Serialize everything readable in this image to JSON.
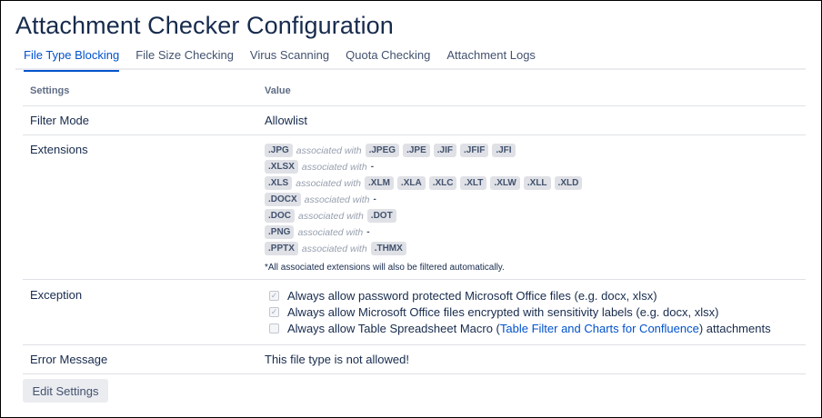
{
  "title": "Attachment Checker Configuration",
  "tabs": [
    "File Type Blocking",
    "File Size Checking",
    "Virus Scanning",
    "Quota Checking",
    "Attachment Logs"
  ],
  "active_tab": "File Type Blocking",
  "table": {
    "headers": {
      "settings": "Settings",
      "value": "Value"
    },
    "filter_mode": {
      "label": "Filter Mode",
      "value": "Allowlist"
    },
    "extensions": {
      "label": "Extensions",
      "assoc_text": "associated with",
      "none_text": "-",
      "items": [
        {
          "ext": ".JPG",
          "assoc": [
            ".JPEG",
            ".JPE",
            ".JIF",
            ".JFIF",
            ".JFI"
          ]
        },
        {
          "ext": ".XLSX",
          "assoc": []
        },
        {
          "ext": ".XLS",
          "assoc": [
            ".XLM",
            ".XLA",
            ".XLC",
            ".XLT",
            ".XLW",
            ".XLL",
            ".XLD"
          ]
        },
        {
          "ext": ".DOCX",
          "assoc": []
        },
        {
          "ext": ".DOC",
          "assoc": [
            ".DOT"
          ]
        },
        {
          "ext": ".PNG",
          "assoc": []
        },
        {
          "ext": ".PPTX",
          "assoc": [
            ".THMX"
          ]
        }
      ],
      "note": "*All associated extensions will also be filtered automatically."
    },
    "exception": {
      "label": "Exception",
      "opt1": {
        "text": "Always allow password protected Microsoft Office files (e.g. docx, xlsx)",
        "checked": true
      },
      "opt2": {
        "text": "Always allow Microsoft Office files encrypted with sensitivity labels (e.g. docx, xlsx)",
        "checked": true
      },
      "opt3": {
        "pre": "Always allow Table Spreadsheet Macro (",
        "link": "Table Filter and Charts for Confluence",
        "post": ") attachments",
        "checked": false
      }
    },
    "error_message": {
      "label": "Error Message",
      "value": "This file type is not allowed!"
    }
  },
  "edit_button": "Edit Settings"
}
